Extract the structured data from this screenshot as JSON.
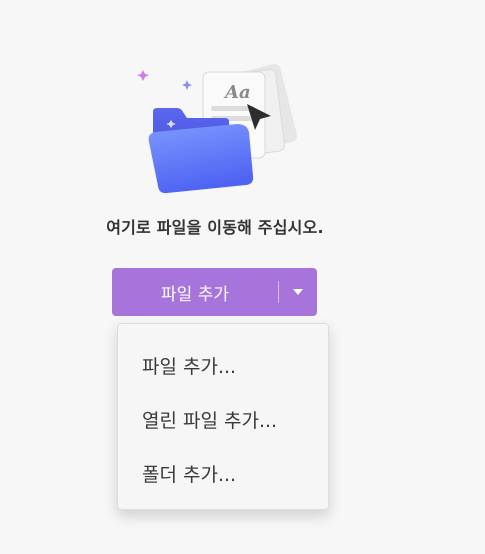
{
  "illustration": {
    "label": "Aa",
    "colors": {
      "folder": "#5a6ff5",
      "sparkle_pink": "#d47ae8",
      "sparkle_blue": "#8a93f2"
    }
  },
  "drop_message": "여기로 파일을 이동해 주십시오.",
  "add_button": {
    "label": "파일 추가",
    "color": "#a774dc"
  },
  "menu": {
    "items": [
      {
        "label": "파일 추가..."
      },
      {
        "label": "열린 파일 추가..."
      },
      {
        "label": "폴더 추가..."
      }
    ]
  }
}
